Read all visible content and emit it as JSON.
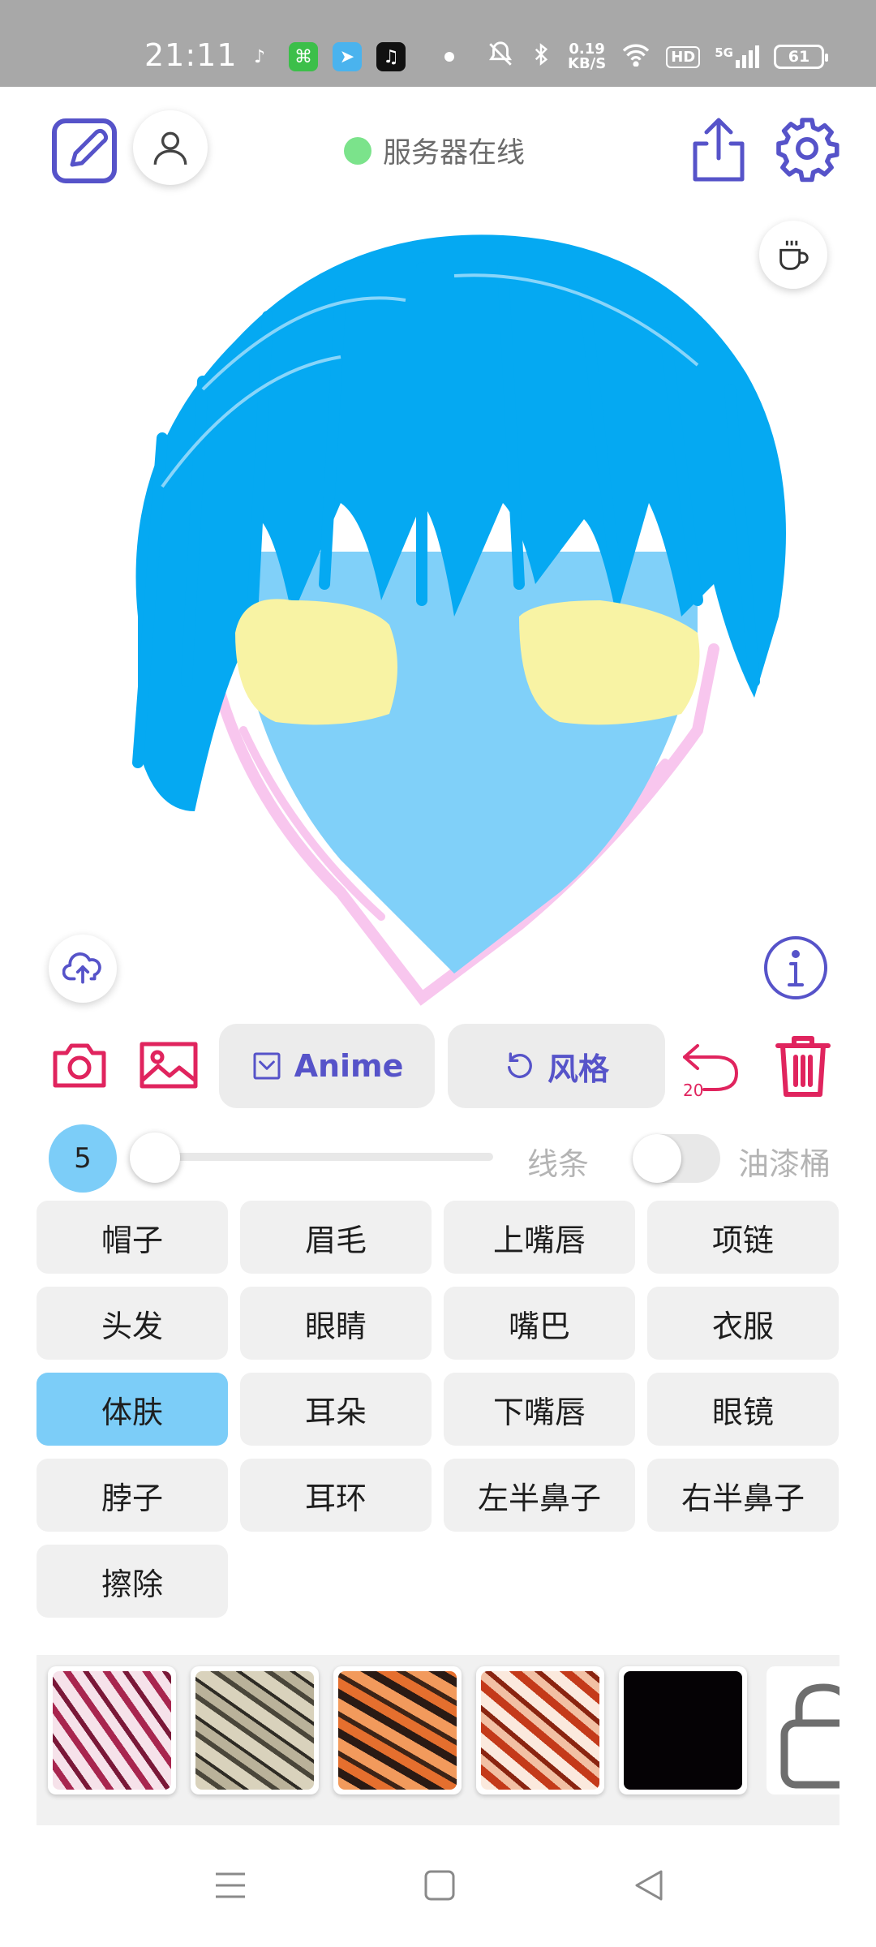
{
  "status_bar": {
    "time": "21:11",
    "network_speed_value": "0.19",
    "network_speed_unit": "KB/S",
    "hd_badge": "HD",
    "cell_type": "5G",
    "battery": "61",
    "icons": [
      "music-note-icon",
      "app-icon",
      "telegram-icon",
      "tiktok-icon",
      "mute-icon",
      "bluetooth-icon",
      "wifi-icon",
      "signal-icon",
      "battery-icon"
    ]
  },
  "header": {
    "server_status_text": "服务器在线",
    "server_status_color": "#7be38b"
  },
  "toolbar": {
    "anime_label": "Anime",
    "style_label": "风格",
    "undo_count": "20"
  },
  "brush": {
    "size": "5",
    "size_fraction": 0.0,
    "line_label": "线条",
    "bucket_label": "油漆桶",
    "bucket_enabled": false
  },
  "parts": [
    {
      "label": "帽子",
      "active": false
    },
    {
      "label": "眉毛",
      "active": false
    },
    {
      "label": "上嘴唇",
      "active": false
    },
    {
      "label": "项链",
      "active": false
    },
    {
      "label": "头发",
      "active": false
    },
    {
      "label": "眼睛",
      "active": false
    },
    {
      "label": "嘴巴",
      "active": false
    },
    {
      "label": "衣服",
      "active": false
    },
    {
      "label": "体肤",
      "active": true
    },
    {
      "label": "耳朵",
      "active": false
    },
    {
      "label": "下嘴唇",
      "active": false
    },
    {
      "label": "眼镜",
      "active": false
    },
    {
      "label": "脖子",
      "active": false
    },
    {
      "label": "耳环",
      "active": false
    },
    {
      "label": "左半鼻子",
      "active": false
    },
    {
      "label": "右半鼻子",
      "active": false
    },
    {
      "label": "擦除",
      "active": false
    }
  ],
  "colors": {
    "accent": "#5653c9",
    "danger": "#e0245e",
    "selected_part": "#7ccdf8",
    "hair": "#05a9f2",
    "skin": "#80d0f9",
    "cheeks": "#f8f3a4",
    "outline": "#f8c6ee"
  },
  "textures": [
    "pink-marble",
    "grey-marble",
    "orange-tiger",
    "red-tiger",
    "black",
    "locked"
  ]
}
